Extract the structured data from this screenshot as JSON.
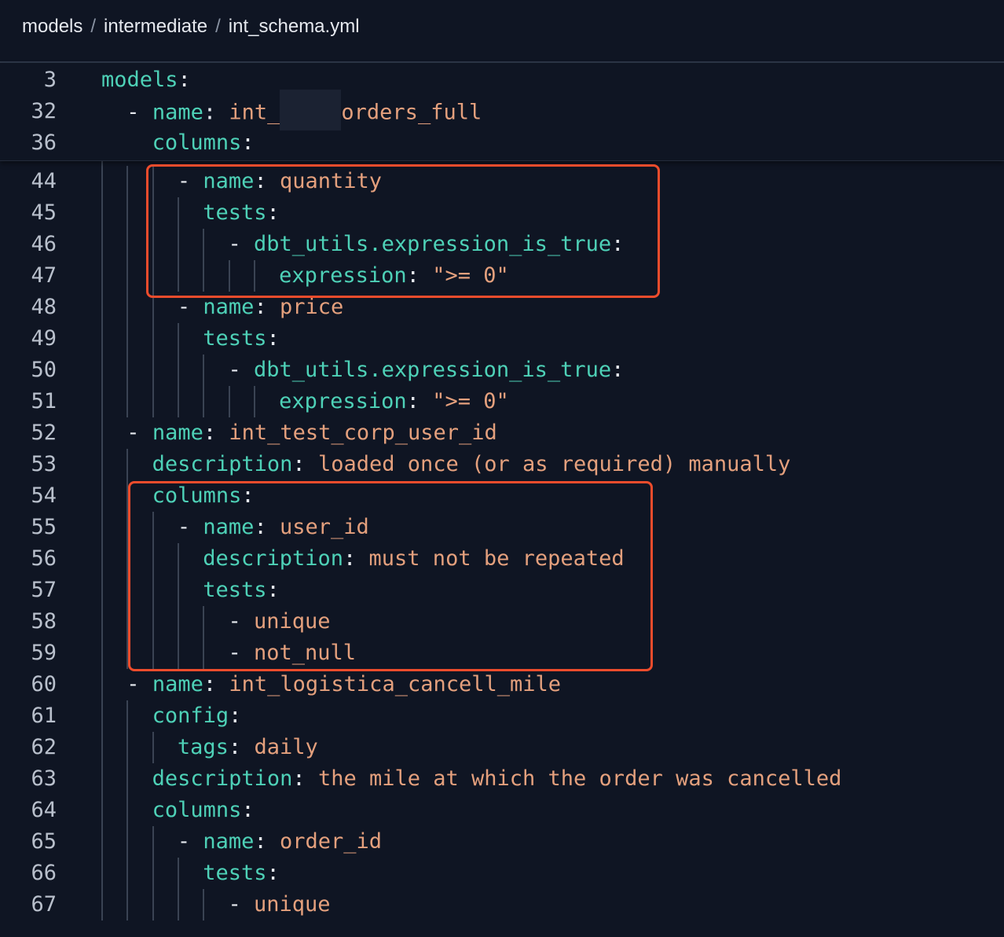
{
  "breadcrumb": [
    "models",
    "intermediate",
    "int_schema.yml"
  ],
  "sticky_lines": [
    {
      "ln": "3",
      "indent": 0,
      "dash": false,
      "key": "models",
      "val": ""
    },
    {
      "ln": "32",
      "indent": 1,
      "dash": true,
      "key": "name",
      "val_pre": "int_",
      "val_post": "orders_full",
      "redacted": true
    },
    {
      "ln": "36",
      "indent": 2,
      "dash": false,
      "key": "columns",
      "val": ""
    }
  ],
  "lines": [
    {
      "ln": "44",
      "indent": 3,
      "dash": true,
      "key": "name",
      "val": "quantity"
    },
    {
      "ln": "45",
      "indent": 4,
      "dash": false,
      "key": "tests",
      "val": ""
    },
    {
      "ln": "46",
      "indent": 5,
      "dash": true,
      "key": "dbt_utils.expression_is_true",
      "val": ""
    },
    {
      "ln": "47",
      "indent": 7,
      "dash": false,
      "key": "expression",
      "val": "\">= 0\""
    },
    {
      "ln": "48",
      "indent": 3,
      "dash": true,
      "key": "name",
      "val": "price"
    },
    {
      "ln": "49",
      "indent": 4,
      "dash": false,
      "key": "tests",
      "val": ""
    },
    {
      "ln": "50",
      "indent": 5,
      "dash": true,
      "key": "dbt_utils.expression_is_true",
      "val": ""
    },
    {
      "ln": "51",
      "indent": 7,
      "dash": false,
      "key": "expression",
      "val": "\">= 0\""
    },
    {
      "ln": "52",
      "indent": 1,
      "dash": true,
      "key": "name",
      "val": "int_test_corp_user_id"
    },
    {
      "ln": "53",
      "indent": 2,
      "dash": false,
      "key": "description",
      "val": "loaded once (or as required) manually"
    },
    {
      "ln": "54",
      "indent": 2,
      "dash": false,
      "key": "columns",
      "val": ""
    },
    {
      "ln": "55",
      "indent": 3,
      "dash": true,
      "key": "name",
      "val": "user_id"
    },
    {
      "ln": "56",
      "indent": 4,
      "dash": false,
      "key": "description",
      "val": "must not be repeated"
    },
    {
      "ln": "57",
      "indent": 4,
      "dash": false,
      "key": "tests",
      "val": ""
    },
    {
      "ln": "58",
      "indent": 5,
      "dash": true,
      "key": "",
      "val": "unique"
    },
    {
      "ln": "59",
      "indent": 5,
      "dash": true,
      "key": "",
      "val": "not_null"
    },
    {
      "ln": "60",
      "indent": 1,
      "dash": true,
      "key": "name",
      "val": "int_logistica_cancell_mile"
    },
    {
      "ln": "61",
      "indent": 2,
      "dash": false,
      "key": "config",
      "val": ""
    },
    {
      "ln": "62",
      "indent": 3,
      "dash": false,
      "key": "tags",
      "val": "daily"
    },
    {
      "ln": "63",
      "indent": 2,
      "dash": false,
      "key": "description",
      "val": "the mile at which the order was cancelled"
    },
    {
      "ln": "64",
      "indent": 2,
      "dash": false,
      "key": "columns",
      "val": ""
    },
    {
      "ln": "65",
      "indent": 3,
      "dash": true,
      "key": "name",
      "val": "order_id"
    },
    {
      "ln": "66",
      "indent": 4,
      "dash": false,
      "key": "tests",
      "val": ""
    },
    {
      "ln": "67",
      "indent": 5,
      "dash": true,
      "key": "",
      "val": "unique"
    }
  ],
  "colors": {
    "background": "#0f1523",
    "key": "#4ed1b7",
    "value": "#e4a07d",
    "highlight": "#ee4c2c"
  }
}
